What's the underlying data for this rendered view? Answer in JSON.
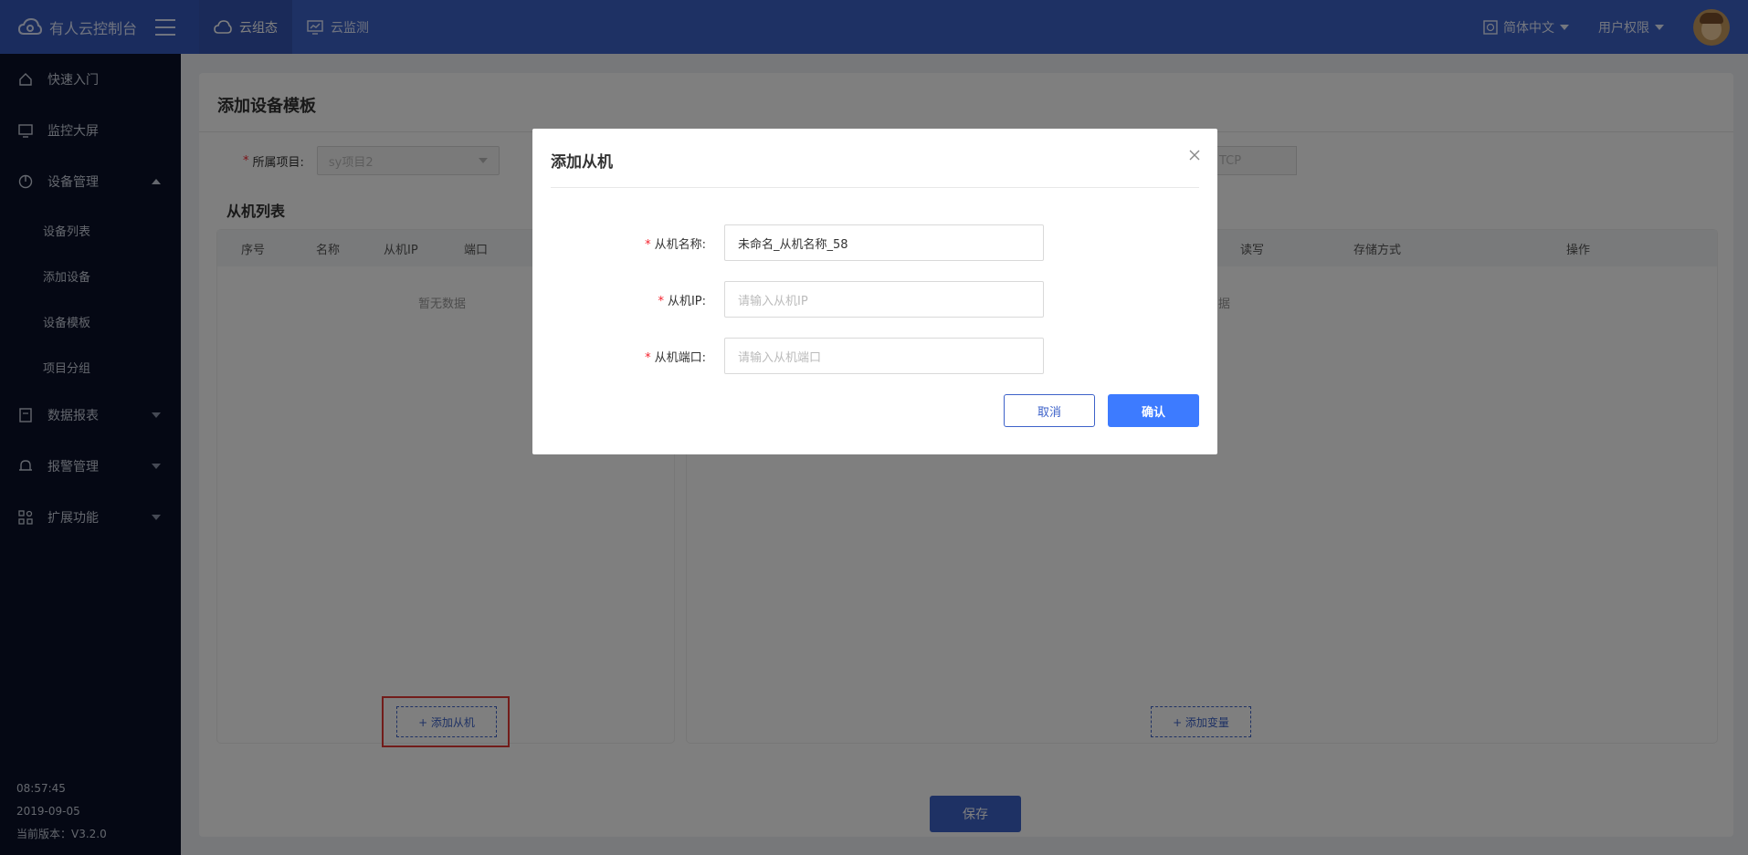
{
  "topbar": {
    "app_name": "有人云控制台",
    "tabs": [
      {
        "label": "云组态",
        "icon": "cloud-icon",
        "active": true
      },
      {
        "label": "云监测",
        "icon": "monitor-chart-icon",
        "active": false
      }
    ],
    "language": "简体中文",
    "permission": "用户权限"
  },
  "sidebar": {
    "items": [
      {
        "label": "快速入门",
        "icon": "home-icon"
      },
      {
        "label": "监控大屏",
        "icon": "screen-icon"
      },
      {
        "label": "设备管理",
        "icon": "clock-icon",
        "expanded": true
      },
      {
        "label": "数据报表",
        "icon": "report-icon"
      },
      {
        "label": "报警管理",
        "icon": "bell-icon"
      },
      {
        "label": "扩展功能",
        "icon": "apps-icon"
      }
    ],
    "sub_items": [
      "设备列表",
      "添加设备",
      "设备模板",
      "项目分组"
    ],
    "footer": {
      "time": "08:57:45",
      "date": "2019-09-05",
      "version": "当前版本：V3.2.0"
    }
  },
  "main": {
    "title": "添加设备模板",
    "project_label": "所属项目:",
    "project_value": "sy项目2",
    "protocol_value": "TCP",
    "slave_list_title": "从机列表",
    "slave_columns": [
      "序号",
      "名称",
      "从机IP",
      "端口"
    ],
    "empty_text": "暂无数据",
    "var_columns": [
      "读写",
      "存储方式",
      "操作"
    ],
    "var_empty_text": "据",
    "add_slave_btn": "+ 添加从机",
    "add_var_btn": "+ 添加变量",
    "save_btn": "保存"
  },
  "dialog": {
    "title": "添加从机",
    "fields": [
      {
        "label": "从机名称:",
        "value": "未命名_从机名称_58",
        "placeholder": ""
      },
      {
        "label": "从机IP:",
        "value": "",
        "placeholder": "请输入从机IP"
      },
      {
        "label": "从机端口:",
        "value": "",
        "placeholder": "请输入从机端口"
      }
    ],
    "cancel": "取消",
    "confirm": "确认"
  }
}
